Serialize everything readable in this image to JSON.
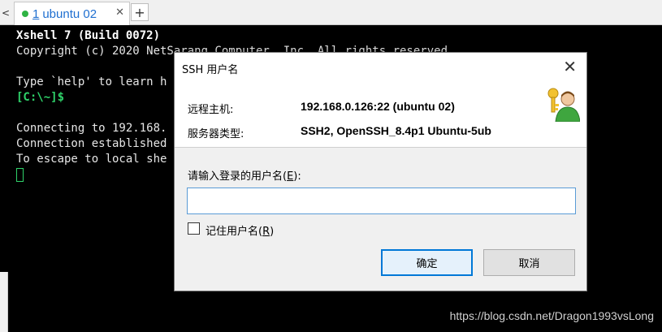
{
  "tabbar": {
    "scroll_left": "<",
    "tab": {
      "number": "1",
      "title": "ubuntu 02",
      "close": "✕"
    },
    "add": "+"
  },
  "terminal": {
    "lines": [
      "Xshell 7 (Build 0072)",
      "Copyright (c) 2020 NetSarang Computer, Inc. All rights reserved.",
      "Type `help' to learn h",
      "[C:\\~]$",
      "Connecting to 192.168.",
      "Connection established",
      "To escape to local she"
    ]
  },
  "dialog": {
    "title": "SSH 用户名",
    "close": "✕",
    "remote_host_label": "远程主机:",
    "remote_host_value": "192.168.0.126:22 (ubuntu 02)",
    "server_type_label": "服务器类型:",
    "server_type_value": "SSH2, OpenSSH_8.4p1 Ubuntu-5ub",
    "prompt_label_prefix": "请输入登录的用户名(",
    "prompt_label_key": "E",
    "prompt_label_suffix": "):",
    "username_value": "",
    "remember_prefix": "记住用户名(",
    "remember_key": "R",
    "remember_suffix": ")",
    "remember_checked": false,
    "ok_label": "确定",
    "cancel_label": "取消"
  },
  "watermark": "https://blog.csdn.net/Dragon1993vsLong",
  "colors": {
    "terminal_bg": "#000000",
    "prompt_green": "#2fd36a",
    "tab_text": "#1f6fd0",
    "focus_blue": "#0078d7"
  },
  "icons": {
    "host": "user-key-icon"
  }
}
